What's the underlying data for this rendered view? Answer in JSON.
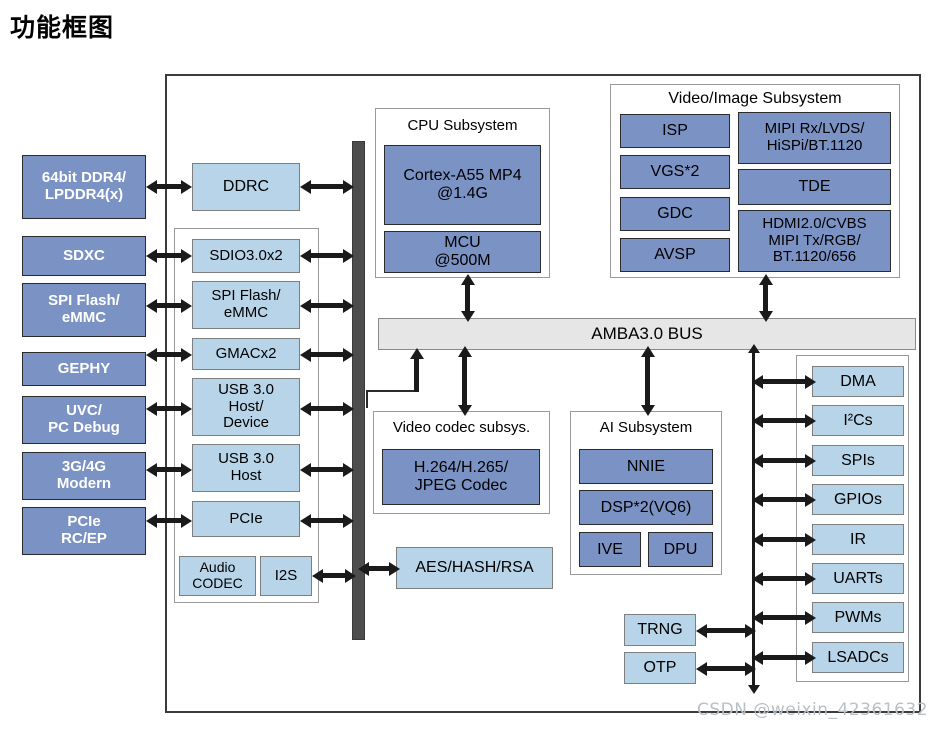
{
  "title": "功能框图",
  "watermark": "CSDN @weixin_42361632",
  "colors": {
    "block_dark_blue": "#7b92c4",
    "block_light_blue": "#b8d4e8",
    "bus_gray": "#e6e6e6",
    "bus_bar_dark": "#4d4d4d",
    "frame_border": "#3b3b3b"
  },
  "external_interfaces": [
    {
      "label": "64bit DDR4/\nLPDDR4(x)"
    },
    {
      "label": "SDXC"
    },
    {
      "label": "SPI Flash/\neMMC"
    },
    {
      "label": "GEPHY"
    },
    {
      "label": "UVC/\nPC Debug"
    },
    {
      "label": "3G/4G\nModern"
    },
    {
      "label": "PCIe\nRC/EP"
    }
  ],
  "memory_controller": {
    "label": "DDRC"
  },
  "peripheral_interfaces": [
    {
      "label": "SDIO3.0x2"
    },
    {
      "label": "SPI Flash/\neMMC"
    },
    {
      "label": "GMACx2"
    },
    {
      "label": "USB 3.0\nHost/\nDevice"
    },
    {
      "label": "USB 3.0\nHost"
    },
    {
      "label": "PCIe"
    }
  ],
  "audio": {
    "codec_label": "Audio\nCODEC",
    "i2s_label": "I2S"
  },
  "cpu_subsystem": {
    "title": "CPU Subsystem",
    "blocks": [
      {
        "label": "Cortex-A55 MP4\n@1.4G"
      },
      {
        "label": "MCU\n@500M"
      }
    ]
  },
  "video_image_subsystem": {
    "title": "Video/Image Subsystem",
    "left_blocks": [
      {
        "label": "ISP"
      },
      {
        "label": "VGS*2"
      },
      {
        "label": "GDC"
      },
      {
        "label": "AVSP"
      }
    ],
    "right_blocks": [
      {
        "label": "MIPI Rx/LVDS/\nHiSPi/BT.1120"
      },
      {
        "label": "TDE"
      },
      {
        "label": "HDMI2.0/CVBS\nMIPI Tx/RGB/\nBT.1120/656"
      }
    ]
  },
  "bus": {
    "label": "AMBA3.0 BUS"
  },
  "video_codec_subsystem": {
    "title": "Video codec subsys.",
    "blocks": [
      {
        "label": "H.264/H.265/\nJPEG Codec"
      }
    ]
  },
  "ai_subsystem": {
    "title": "AI Subsystem",
    "blocks": [
      {
        "label": "NNIE"
      },
      {
        "label": "DSP*2(VQ6)"
      },
      {
        "label": "IVE"
      },
      {
        "label": "DPU"
      }
    ]
  },
  "crypto": {
    "label": "AES/HASH/RSA"
  },
  "security_blocks": [
    {
      "label": "TRNG"
    },
    {
      "label": "OTP"
    }
  ],
  "low_speed_peripherals": [
    {
      "label": "DMA"
    },
    {
      "label": "I²Cs"
    },
    {
      "label": "SPIs"
    },
    {
      "label": "GPIOs"
    },
    {
      "label": "IR"
    },
    {
      "label": "UARTs"
    },
    {
      "label": "PWMs"
    },
    {
      "label": "LSADCs"
    }
  ]
}
